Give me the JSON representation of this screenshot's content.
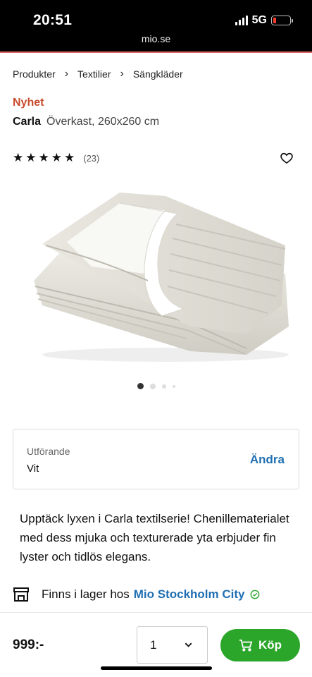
{
  "status_bar": {
    "time": "20:51",
    "url": "mio.se",
    "network": "5G"
  },
  "breadcrumb": {
    "items": [
      "Produkter",
      "Textilier",
      "Sängkläder"
    ]
  },
  "product": {
    "badge": "Nyhet",
    "name": "Carla",
    "subtitle": "Överkast, 260x260 cm",
    "rating": {
      "stars": 5,
      "count": "(23)"
    },
    "image_count": 4,
    "active_image": 1
  },
  "variant": {
    "label": "Utförande",
    "value": "Vit",
    "change_label": "Ändra"
  },
  "description": "Upptäck lyxen i Carla textilserie! Chenillematerialet med dess mjuka och texturerade yta erbjuder fin lyster och tidlös elegans.",
  "stock": {
    "text": "Finns i lager hos",
    "store": "Mio Stockholm City"
  },
  "purchase": {
    "price": "999:-",
    "quantity": "1",
    "buy_label": "Köp"
  },
  "colors": {
    "brand_red": "#c84b2d",
    "link_blue": "#1f6fb2",
    "buy_green": "#2ba52a"
  }
}
